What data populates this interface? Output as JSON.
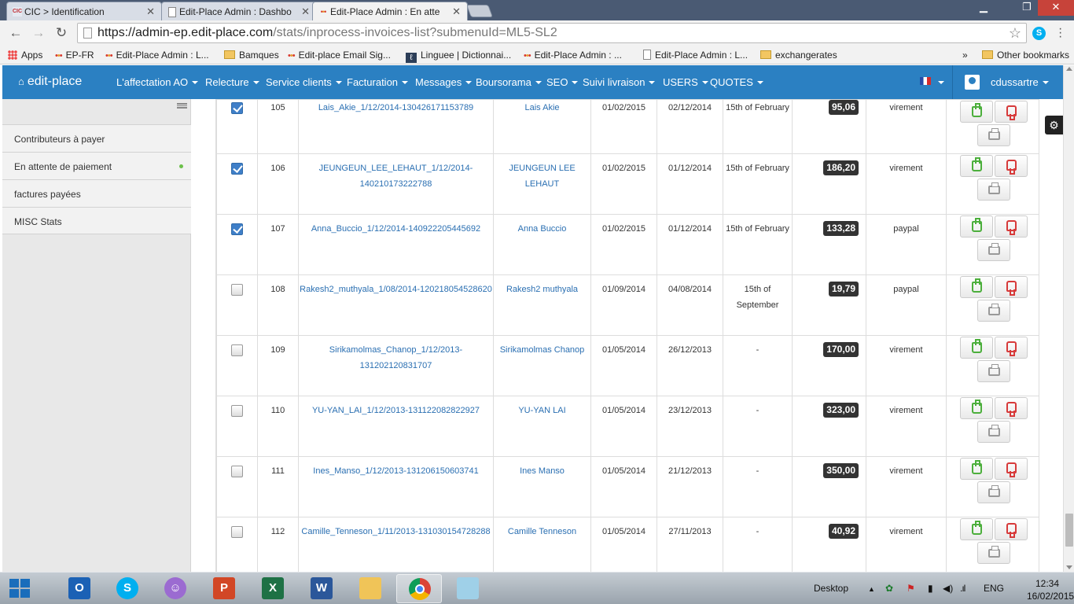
{
  "browser": {
    "tabs": [
      {
        "title": "CIC > Identification",
        "favicon": "CIC"
      },
      {
        "title": "Edit-Place Admin : Dashbo",
        "favicon": "doc"
      },
      {
        "title": "Edit-Place Admin : En atte",
        "favicon": "dots"
      }
    ],
    "url_host": "https://admin-ep.edit-place.com",
    "url_path": "/stats/inprocess-invoices-list?submenuId=ML5-SL2",
    "bookmarks": [
      {
        "label": "Apps",
        "icon": "apps-grid-icon"
      },
      {
        "label": "EP-FR",
        "icon": "dots-icon"
      },
      {
        "label": "Edit-Place Admin : L...",
        "icon": "dots-icon"
      },
      {
        "label": "Bamques",
        "icon": "folder-icon"
      },
      {
        "label": "Edit-place Email Sig...",
        "icon": "dots-icon"
      },
      {
        "label": "Linguee | Dictionnai...",
        "icon": "linguee-icon"
      },
      {
        "label": "Edit-Place Admin : ...",
        "icon": "dots-icon"
      },
      {
        "label": "Edit-Place Admin : L...",
        "icon": "doc-icon"
      },
      {
        "label": "exchangerates",
        "icon": "folder-icon"
      }
    ],
    "overflow": "»",
    "other_bookmarks": "Other bookmarks"
  },
  "nav": {
    "brand": "edit-place",
    "items": [
      "L'affectation AO",
      "Relecture",
      "Service clients",
      "Facturation",
      "Messages",
      "Boursorama",
      "SEO",
      "Suivi livraison",
      "USERS",
      "QUOTES"
    ],
    "username": "cdussartre"
  },
  "sidebar": {
    "items": [
      "Contributeurs à payer",
      "En attente de paiement",
      "factures payées",
      "MISC Stats"
    ]
  },
  "rows": [
    {
      "checked": true,
      "num": "105",
      "invoice": "Lais_Akie_1/12/2014-1304261711537​89",
      "name": "Lais Akie",
      "date1": "01/02/2015",
      "date2": "02/12/2014",
      "due": "15th of February",
      "amount": "95,06",
      "method": "virement"
    },
    {
      "checked": true,
      "num": "106",
      "invoice": "JEUNGEUN_LEE_LEHAUT_1/12/2014-140210173222788",
      "name": "JEUNGEUN LEE LEHAUT",
      "date1": "01/02/2015",
      "date2": "01/12/2014",
      "due": "15th of February",
      "amount": "186,20",
      "method": "virement"
    },
    {
      "checked": true,
      "num": "107",
      "invoice": "Anna_Buccio_1/12/2014-140922205445692",
      "name": "Anna Buccio",
      "date1": "01/02/2015",
      "date2": "01/12/2014",
      "due": "15th of February",
      "amount": "133,28",
      "method": "paypal"
    },
    {
      "checked": false,
      "num": "108",
      "invoice": "Rakesh2_muthyala_1/08/2014-120218054528620",
      "name": "Rakesh2 muthyala",
      "date1": "01/09/2014",
      "date2": "04/08/2014",
      "due": "15th of September",
      "amount": "19,79",
      "method": "paypal"
    },
    {
      "checked": false,
      "num": "109",
      "invoice": "Sirikamolmas_Chanop_1/12/2013-131202120831707",
      "name": "Sirikamolmas Chanop",
      "date1": "01/05/2014",
      "date2": "26/12/2013",
      "due": "-",
      "amount": "170,00",
      "method": "virement"
    },
    {
      "checked": false,
      "num": "110",
      "invoice": "YU-YAN_LAI_1/12/2013-131122082822927",
      "name": "YU-YAN LAI",
      "date1": "01/05/2014",
      "date2": "23/12/2013",
      "due": "-",
      "amount": "323,00",
      "method": "virement"
    },
    {
      "checked": false,
      "num": "111",
      "invoice": "Ines_Manso_1/12/2013-131206150603741",
      "name": "Ines Manso",
      "date1": "01/05/2014",
      "date2": "21/12/2013",
      "due": "-",
      "amount": "350,00",
      "method": "virement"
    },
    {
      "checked": false,
      "num": "112",
      "invoice": "Camille_Tenneson_1/11/2013-131030154728288",
      "name": "Camille Tenneson",
      "date1": "01/05/2014",
      "date2": "27/11/2013",
      "due": "-",
      "amount": "40,92",
      "method": "virement"
    }
  ],
  "taskbar": {
    "apps": [
      "outlook-icon",
      "skype-icon",
      "messenger-icon",
      "powerpoint-icon",
      "excel-icon",
      "word-icon",
      "explorer-icon",
      "chrome-icon",
      "notepad-icon"
    ],
    "desktop": "Desktop",
    "lang": "ENG",
    "time": "12:34",
    "date": "16/02/2015"
  },
  "colors": {
    "navbar": "#2b80c2",
    "link": "#2a6fb2",
    "approve": "#4caf3c",
    "reject": "#d73a3a"
  }
}
